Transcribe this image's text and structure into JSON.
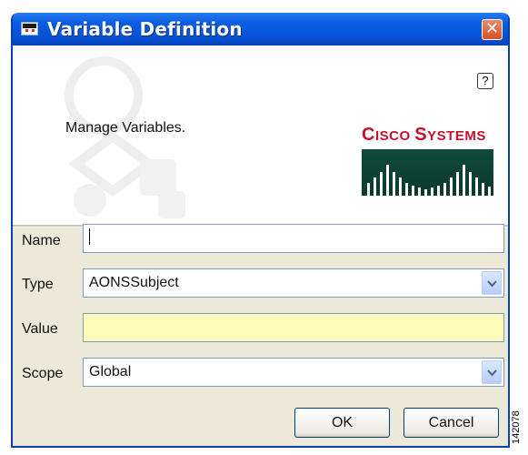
{
  "window": {
    "title": "Variable Definition",
    "close_icon": "close-icon",
    "accent": "#0553d6"
  },
  "header": {
    "help_label": "?",
    "description": "Manage Variables.",
    "brand_big": "C",
    "brand_rest": "ISCO ",
    "brand_big2": "S",
    "brand_rest2": "YSTEMS",
    "brand_color": "#c8102e"
  },
  "form": {
    "name_label": "Name",
    "name_value": "",
    "type_label": "Type",
    "type_value": "AONSSubject",
    "value_label": "Value",
    "value_value": "",
    "scope_label": "Scope",
    "scope_value": "Global"
  },
  "buttons": {
    "ok": "OK",
    "cancel": "Cancel"
  },
  "figure_id": "142078"
}
